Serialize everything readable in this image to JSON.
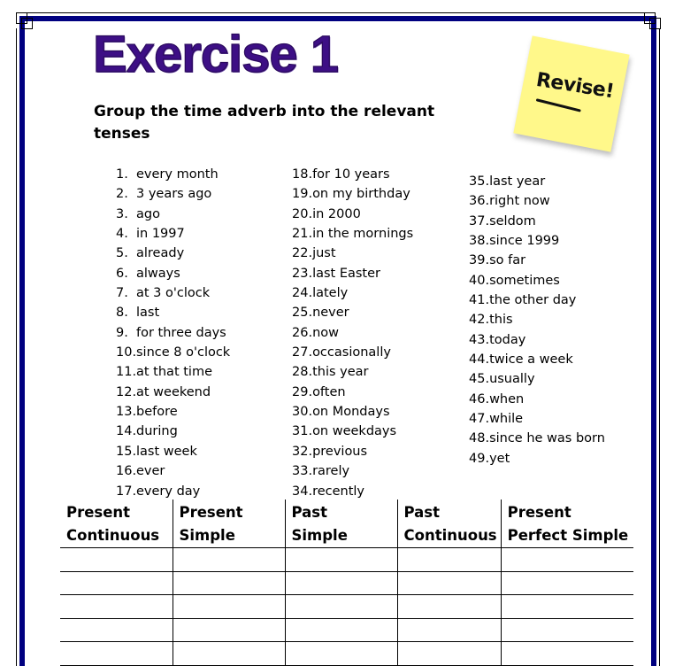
{
  "title": "Exercise 1",
  "instruction": "Group the time adverb into the relevant tenses",
  "sticky_note": {
    "text": "Revise!",
    "color": "#fff88a"
  },
  "colors": {
    "border": "#000080",
    "title": "#3d0f85"
  },
  "adverbs": {
    "column1": [
      {
        "num": "1.",
        "text": "every month"
      },
      {
        "num": "2.",
        "text": "3 years ago"
      },
      {
        "num": "3.",
        "text": "ago"
      },
      {
        "num": "4.",
        "text": "in 1997"
      },
      {
        "num": "5.",
        "text": "already"
      },
      {
        "num": "6.",
        "text": "always"
      },
      {
        "num": "7.",
        "text": "at 3 o'clock"
      },
      {
        "num": "8.",
        "text": "last"
      },
      {
        "num": "9.",
        "text": "for three days"
      },
      {
        "num": "10.",
        "text": "since 8 o'clock"
      },
      {
        "num": "11.",
        "text": "at that time"
      },
      {
        "num": "12.",
        "text": "at weekend"
      },
      {
        "num": "13.",
        "text": "before"
      },
      {
        "num": "14.",
        "text": "during"
      },
      {
        "num": "15.",
        "text": "last week"
      },
      {
        "num": "16.",
        "text": "ever"
      },
      {
        "num": "17.",
        "text": "every day"
      }
    ],
    "column2": [
      {
        "num": "18.",
        "text": "for 10 years"
      },
      {
        "num": "19.",
        "text": "on my birthday"
      },
      {
        "num": "20.",
        "text": "in 2000"
      },
      {
        "num": "21.",
        "text": "in the mornings"
      },
      {
        "num": "22.",
        "text": "just"
      },
      {
        "num": "23.",
        "text": "last Easter"
      },
      {
        "num": "24.",
        "text": "lately"
      },
      {
        "num": "25.",
        "text": "never"
      },
      {
        "num": "26.",
        "text": "now"
      },
      {
        "num": "27.",
        "text": "occasionally"
      },
      {
        "num": "28.",
        "text": "this year"
      },
      {
        "num": "29.",
        "text": "often"
      },
      {
        "num": "30.",
        "text": "on Mondays"
      },
      {
        "num": "31.",
        "text": "on weekdays"
      },
      {
        "num": "32.",
        "text": "previous"
      },
      {
        "num": "33.",
        "text": "rarely"
      },
      {
        "num": "34.",
        "text": "recently"
      }
    ],
    "column3": [
      {
        "num": "35.",
        "text": "last year"
      },
      {
        "num": "36.",
        "text": "right now"
      },
      {
        "num": "37.",
        "text": "seldom"
      },
      {
        "num": "38.",
        "text": "since 1999"
      },
      {
        "num": "39.",
        "text": "so far"
      },
      {
        "num": "40.",
        "text": "sometimes"
      },
      {
        "num": "41.",
        "text": "the other day"
      },
      {
        "num": "42.",
        "text": "this"
      },
      {
        "num": "43.",
        "text": "today"
      },
      {
        "num": "44.",
        "text": "twice a week"
      },
      {
        "num": "45.",
        "text": "usually"
      },
      {
        "num": "46.",
        "text": "when"
      },
      {
        "num": "47.",
        "text": "while"
      },
      {
        "num": "48.",
        "text": "since he was born"
      },
      {
        "num": "49.",
        "text": "yet"
      }
    ]
  },
  "table": {
    "headers": [
      {
        "line1": "Present",
        "line2": "Continuous"
      },
      {
        "line1": "Present",
        "line2": "Simple"
      },
      {
        "line1": "Past",
        "line2": "Simple"
      },
      {
        "line1": "Past",
        "line2": "Continuous"
      },
      {
        "line1": "Present",
        "line2": "Perfect Simple"
      }
    ],
    "empty_rows": 5
  }
}
